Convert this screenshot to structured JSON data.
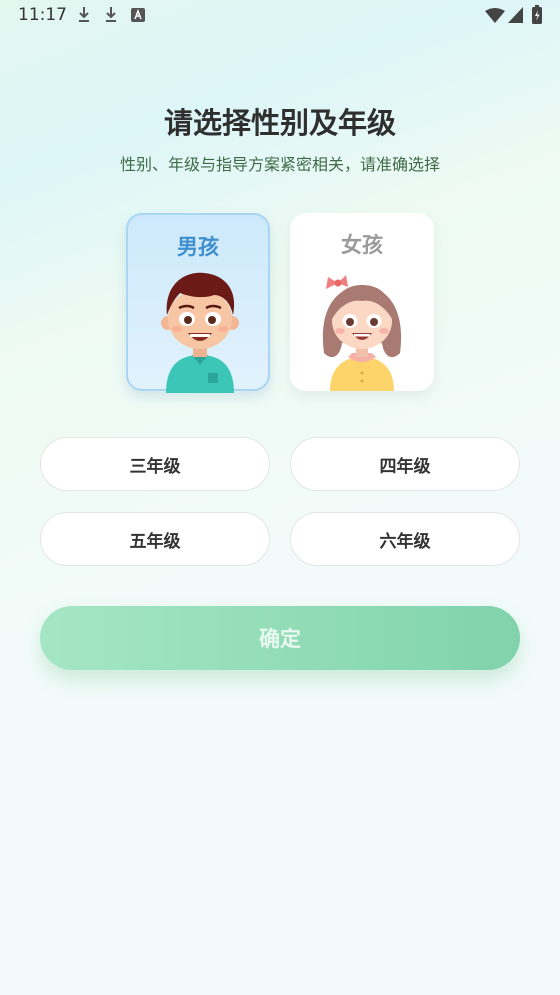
{
  "status_bar": {
    "time": "11:17"
  },
  "header": {
    "title": "请选择性别及年级",
    "subtitle": "性别、年级与指导方案紧密相关，请准确选择"
  },
  "gender": {
    "options": [
      {
        "label": "男孩",
        "selected": true
      },
      {
        "label": "女孩",
        "selected": false
      }
    ]
  },
  "grades": [
    "三年级",
    "四年级",
    "五年级",
    "六年级"
  ],
  "confirm_label": "确定"
}
